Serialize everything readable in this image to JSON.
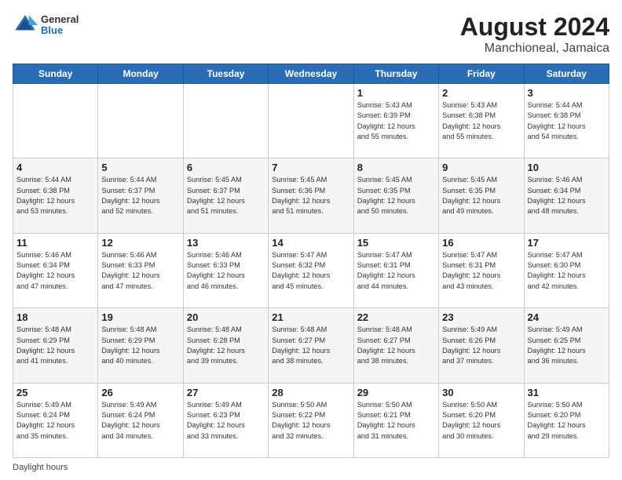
{
  "header": {
    "logo_line1": "General",
    "logo_line2": "Blue",
    "title": "August 2024",
    "subtitle": "Manchioneal, Jamaica"
  },
  "calendar": {
    "days_of_week": [
      "Sunday",
      "Monday",
      "Tuesday",
      "Wednesday",
      "Thursday",
      "Friday",
      "Saturday"
    ],
    "weeks": [
      [
        {
          "day": "",
          "info": ""
        },
        {
          "day": "",
          "info": ""
        },
        {
          "day": "",
          "info": ""
        },
        {
          "day": "",
          "info": ""
        },
        {
          "day": "1",
          "info": "Sunrise: 5:43 AM\nSunset: 6:39 PM\nDaylight: 12 hours\nand 55 minutes."
        },
        {
          "day": "2",
          "info": "Sunrise: 5:43 AM\nSunset: 6:38 PM\nDaylight: 12 hours\nand 55 minutes."
        },
        {
          "day": "3",
          "info": "Sunrise: 5:44 AM\nSunset: 6:38 PM\nDaylight: 12 hours\nand 54 minutes."
        }
      ],
      [
        {
          "day": "4",
          "info": "Sunrise: 5:44 AM\nSunset: 6:38 PM\nDaylight: 12 hours\nand 53 minutes."
        },
        {
          "day": "5",
          "info": "Sunrise: 5:44 AM\nSunset: 6:37 PM\nDaylight: 12 hours\nand 52 minutes."
        },
        {
          "day": "6",
          "info": "Sunrise: 5:45 AM\nSunset: 6:37 PM\nDaylight: 12 hours\nand 51 minutes."
        },
        {
          "day": "7",
          "info": "Sunrise: 5:45 AM\nSunset: 6:36 PM\nDaylight: 12 hours\nand 51 minutes."
        },
        {
          "day": "8",
          "info": "Sunrise: 5:45 AM\nSunset: 6:35 PM\nDaylight: 12 hours\nand 50 minutes."
        },
        {
          "day": "9",
          "info": "Sunrise: 5:45 AM\nSunset: 6:35 PM\nDaylight: 12 hours\nand 49 minutes."
        },
        {
          "day": "10",
          "info": "Sunrise: 5:46 AM\nSunset: 6:34 PM\nDaylight: 12 hours\nand 48 minutes."
        }
      ],
      [
        {
          "day": "11",
          "info": "Sunrise: 5:46 AM\nSunset: 6:34 PM\nDaylight: 12 hours\nand 47 minutes."
        },
        {
          "day": "12",
          "info": "Sunrise: 5:46 AM\nSunset: 6:33 PM\nDaylight: 12 hours\nand 47 minutes."
        },
        {
          "day": "13",
          "info": "Sunrise: 5:46 AM\nSunset: 6:33 PM\nDaylight: 12 hours\nand 46 minutes."
        },
        {
          "day": "14",
          "info": "Sunrise: 5:47 AM\nSunset: 6:32 PM\nDaylight: 12 hours\nand 45 minutes."
        },
        {
          "day": "15",
          "info": "Sunrise: 5:47 AM\nSunset: 6:31 PM\nDaylight: 12 hours\nand 44 minutes."
        },
        {
          "day": "16",
          "info": "Sunrise: 5:47 AM\nSunset: 6:31 PM\nDaylight: 12 hours\nand 43 minutes."
        },
        {
          "day": "17",
          "info": "Sunrise: 5:47 AM\nSunset: 6:30 PM\nDaylight: 12 hours\nand 42 minutes."
        }
      ],
      [
        {
          "day": "18",
          "info": "Sunrise: 5:48 AM\nSunset: 6:29 PM\nDaylight: 12 hours\nand 41 minutes."
        },
        {
          "day": "19",
          "info": "Sunrise: 5:48 AM\nSunset: 6:29 PM\nDaylight: 12 hours\nand 40 minutes."
        },
        {
          "day": "20",
          "info": "Sunrise: 5:48 AM\nSunset: 6:28 PM\nDaylight: 12 hours\nand 39 minutes."
        },
        {
          "day": "21",
          "info": "Sunrise: 5:48 AM\nSunset: 6:27 PM\nDaylight: 12 hours\nand 38 minutes."
        },
        {
          "day": "22",
          "info": "Sunrise: 5:48 AM\nSunset: 6:27 PM\nDaylight: 12 hours\nand 38 minutes."
        },
        {
          "day": "23",
          "info": "Sunrise: 5:49 AM\nSunset: 6:26 PM\nDaylight: 12 hours\nand 37 minutes."
        },
        {
          "day": "24",
          "info": "Sunrise: 5:49 AM\nSunset: 6:25 PM\nDaylight: 12 hours\nand 36 minutes."
        }
      ],
      [
        {
          "day": "25",
          "info": "Sunrise: 5:49 AM\nSunset: 6:24 PM\nDaylight: 12 hours\nand 35 minutes."
        },
        {
          "day": "26",
          "info": "Sunrise: 5:49 AM\nSunset: 6:24 PM\nDaylight: 12 hours\nand 34 minutes."
        },
        {
          "day": "27",
          "info": "Sunrise: 5:49 AM\nSunset: 6:23 PM\nDaylight: 12 hours\nand 33 minutes."
        },
        {
          "day": "28",
          "info": "Sunrise: 5:50 AM\nSunset: 6:22 PM\nDaylight: 12 hours\nand 32 minutes."
        },
        {
          "day": "29",
          "info": "Sunrise: 5:50 AM\nSunset: 6:21 PM\nDaylight: 12 hours\nand 31 minutes."
        },
        {
          "day": "30",
          "info": "Sunrise: 5:50 AM\nSunset: 6:20 PM\nDaylight: 12 hours\nand 30 minutes."
        },
        {
          "day": "31",
          "info": "Sunrise: 5:50 AM\nSunset: 6:20 PM\nDaylight: 12 hours\nand 29 minutes."
        }
      ]
    ]
  },
  "footer": {
    "text": "Daylight hours"
  }
}
